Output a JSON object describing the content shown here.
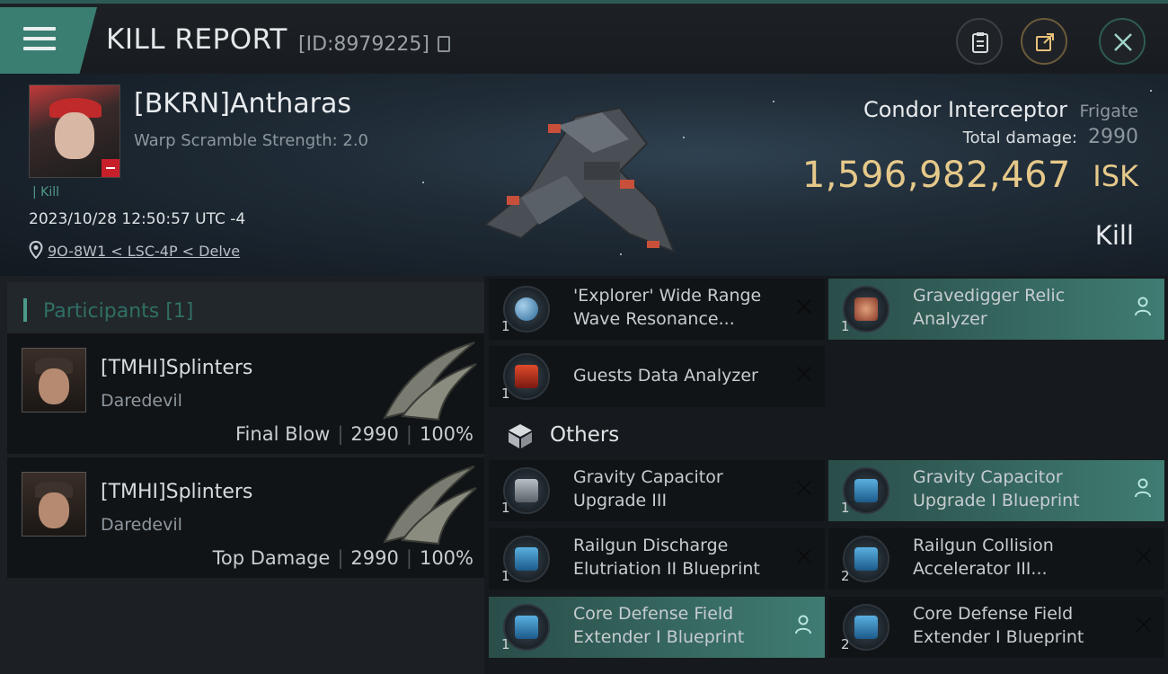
{
  "header": {
    "title": "KILL REPORT",
    "report_id": "[ID:8979225]"
  },
  "victim": {
    "name": "[BKRN]Antharas",
    "scramble": "Warp Scramble Strength: 2.0",
    "tag": "Kill",
    "date": "2023/10/28 12:50:57 UTC -4",
    "location": "9O-8W1 < LSC-4P < Delve"
  },
  "ship": {
    "name": "Condor Interceptor",
    "class": "Frigate",
    "damage_label": "Total damage:",
    "damage_value": "2990",
    "isk_value": "1,596,982,467",
    "isk_unit": "ISK",
    "kill_type": "Kill"
  },
  "participants": {
    "title": "Participants [1]",
    "rows": [
      {
        "name": "[TMHI]Splinters",
        "ship": "Daredevil",
        "label": "Final Blow",
        "damage": "2990",
        "pct": "100%"
      },
      {
        "name": "[TMHI]Splinters",
        "ship": "Daredevil",
        "label": "Top Damage",
        "damage": "2990",
        "pct": "100%"
      }
    ]
  },
  "items": {
    "others_title": "Others",
    "list": [
      {
        "name": "'Explorer' Wide Range Wave Resonance...",
        "qty": "1",
        "status": "destroyed",
        "icon": "globe-icon"
      },
      {
        "name": "Gravedigger Relic Analyzer",
        "qty": "1",
        "status": "dropped",
        "icon": "relic-analyzer-icon"
      },
      {
        "name": "Guests Data Analyzer",
        "qty": "1",
        "status": "destroyed",
        "icon": "data-analyzer-icon"
      },
      {
        "name": "Gravity Capacitor Upgrade III",
        "qty": "1",
        "status": "destroyed",
        "icon": "capacitor-icon"
      },
      {
        "name": "Gravity Capacitor Upgrade I Blueprint",
        "qty": "1",
        "status": "dropped",
        "icon": "blueprint-icon"
      },
      {
        "name": "Railgun Discharge Elutriation II Blueprint",
        "qty": "1",
        "status": "destroyed",
        "icon": "blueprint-icon"
      },
      {
        "name": "Railgun Collision Accelerator III...",
        "qty": "2",
        "status": "destroyed",
        "icon": "blueprint-icon"
      },
      {
        "name": "Core Defense Field Extender I Blueprint",
        "qty": "1",
        "status": "dropped",
        "icon": "blueprint-icon"
      },
      {
        "name": "Core Defense Field Extender I Blueprint",
        "qty": "2",
        "status": "destroyed",
        "icon": "blueprint-icon"
      }
    ]
  },
  "colors": {
    "accent": "#3f7c72",
    "isk": "#e6c98a"
  }
}
